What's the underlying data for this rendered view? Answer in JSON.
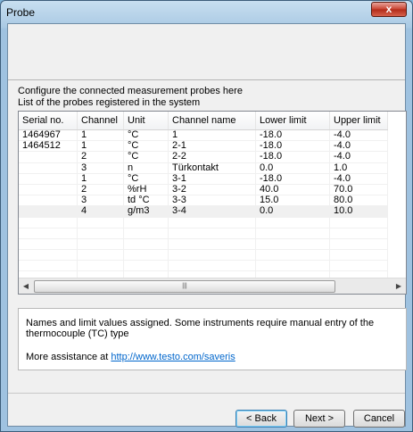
{
  "window": {
    "title": "Probe",
    "close_glyph": "x"
  },
  "intro": {
    "line1": "Configure the connected measurement probes here",
    "line2": "List of the probes registered in the system"
  },
  "table": {
    "columns": [
      "Serial no.",
      "Channel",
      "Unit",
      "Channel name",
      "Lower limit",
      "Upper limit"
    ],
    "rows": [
      [
        "1464967",
        "1",
        "°C",
        "1",
        "-18.0",
        "-4.0"
      ],
      [
        "1464512",
        "1",
        "°C",
        "2-1",
        "-18.0",
        "-4.0"
      ],
      [
        "",
        "2",
        "°C",
        "2-2",
        "-18.0",
        "-4.0"
      ],
      [
        "",
        "3",
        "n",
        "Türkontakt",
        "0.0",
        "1.0"
      ],
      [
        "",
        "1",
        "°C",
        "3-1",
        "-18.0",
        "-4.0"
      ],
      [
        "",
        "2",
        "%rH",
        "3-2",
        "40.0",
        "70.0"
      ],
      [
        "",
        "3",
        "td °C",
        "3-3",
        "15.0",
        "80.0"
      ],
      [
        "",
        "4",
        "g/m3",
        "3-4",
        "0.0",
        "10.0"
      ]
    ],
    "selected_row": 7
  },
  "scrollbar": {
    "thumb_glyph": "|||"
  },
  "info": {
    "message": "Names and limit values assigned. Some instruments require manual entry of the thermocouple (TC) type",
    "more_prefix": "More assistance at ",
    "link": "http://www.testo.com/saveris"
  },
  "buttons": {
    "back": "< Back",
    "next": "Next >",
    "cancel": "Cancel"
  },
  "icons": {
    "close": "close-icon",
    "scroll_left": "chevron-left-icon",
    "scroll_right": "chevron-right-icon"
  }
}
